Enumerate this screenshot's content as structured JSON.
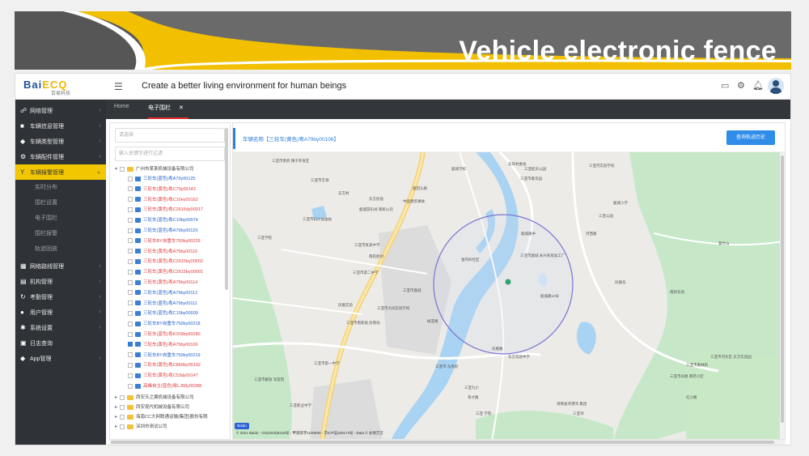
{
  "banner": {
    "title": "Vehicle electronic fence"
  },
  "app": {
    "logo_text_a": "Bai",
    "logo_text_b": "ECQ",
    "logo_sub": "百易科技",
    "slogan": "Create a better living environment for human beings",
    "menu_icon": "hamburger-icon",
    "header_icons": [
      "monitor-icon",
      "gear-icon",
      "bell-icon",
      "user-avatar-icon"
    ]
  },
  "sidebar": {
    "items": [
      {
        "label": "网络管理",
        "icon": "link-icon"
      },
      {
        "label": "车辆信息管理",
        "icon": "truck-icon"
      },
      {
        "label": "车辆类型管理",
        "icon": "cube-icon"
      },
      {
        "label": "车辆配件管理",
        "icon": "gear-icon"
      },
      {
        "label": "车辆报警管理",
        "icon": "y-icon",
        "active": true
      },
      {
        "label": "网络路线管理",
        "icon": "grid-icon"
      },
      {
        "label": "机构管理",
        "icon": "building-icon"
      },
      {
        "label": "考勤管理",
        "icon": "refresh-icon"
      },
      {
        "label": "用户管理",
        "icon": "user-icon"
      },
      {
        "label": "系统设置",
        "icon": "settings-icon"
      },
      {
        "label": "日志查询",
        "icon": "log-icon"
      },
      {
        "label": "App管理",
        "icon": "diamond-icon"
      }
    ],
    "subitems": [
      "实时分布",
      "围栏设置",
      "电子围栏",
      "围栏报警",
      "轨迹回放"
    ]
  },
  "tabs": [
    {
      "label": "Home",
      "active": false
    },
    {
      "label": "电子围栏",
      "active": true
    }
  ],
  "tree": {
    "search1_placeholder": "请选择",
    "search2_placeholder": "输入关键字进行过滤",
    "org_root": "广州市某某机械设备有限公司",
    "vehicles": [
      {
        "label": "三轮车(蓝色)粤A79y00125",
        "color": "blue",
        "checked": false
      },
      {
        "label": "三轮车(黄色)粤C79y00143",
        "color": "red",
        "checked": false
      },
      {
        "label": "三轮车(黄色)粤C10ey00162",
        "color": "red",
        "checked": false
      },
      {
        "label": "三轮车(黄色)粤C2615dy00017",
        "color": "red",
        "checked": false
      },
      {
        "label": "三轮车(蓝色)粤C10by00074",
        "color": "blue",
        "checked": false
      },
      {
        "label": "三轮车(蓝色)粤A79by00120",
        "color": "blue",
        "checked": false
      },
      {
        "label": "三轮车BY自重车750by00226",
        "color": "red",
        "checked": false
      },
      {
        "label": "三轮车(黄色)粤A79by00116",
        "color": "red",
        "checked": false
      },
      {
        "label": "三轮车(黄色)粤C2615by00002",
        "color": "red",
        "checked": false
      },
      {
        "label": "三轮车(黄色)粤C2615by00001",
        "color": "red",
        "checked": false
      },
      {
        "label": "三轮车(黄色)粤A79by00114",
        "color": "red",
        "checked": false
      },
      {
        "label": "三轮车(蓝色)粤A79by00112",
        "color": "blue",
        "checked": false
      },
      {
        "label": "三轮车(蓝色)粤A79by00111",
        "color": "blue",
        "checked": false
      },
      {
        "label": "三轮车(蓝色)粤C10by00009",
        "color": "blue",
        "checked": false
      },
      {
        "label": "三轮车BY自重车750by00218",
        "color": "blue",
        "checked": false
      },
      {
        "label": "三轮车(蓝色)粤K209by00280",
        "color": "red",
        "checked": false
      },
      {
        "label": "三轮车(黄色)粤A79by00106",
        "color": "red",
        "checked": true
      },
      {
        "label": "三轮车BY自重车750by00219",
        "color": "blue",
        "checked": false
      },
      {
        "label": "三轮车(黄色)粤C860by00192",
        "color": "red",
        "checked": false
      },
      {
        "label": "三轮车(黄色)粤C53dy00147",
        "color": "red",
        "checked": false
      },
      {
        "label": "高峰自主(蓝色)粤LJ58y00288",
        "color": "red",
        "checked": false
      }
    ],
    "orgs": [
      "西安天之翼机械设备有限公司",
      "西安现代机械设备有限公司",
      "海南CC大网联通运输(集团)股份有限",
      "深圳市测试公司"
    ]
  },
  "map_panel": {
    "vehicle_label": "车辆名称【三轮车(黄色)粤A79by00106】",
    "history_button": "查询轨迹历史",
    "copyright": "© 2021 Baidu - GS(2019)5218号 - 甲测资字1100930 - 京ICP证030173号 - Data © 长地万方",
    "baidu": "Baidu",
    "labels": [
      "三亚市南旁 镇子开发区",
      "鹿城学校",
      "东岸村委会",
      "三亚市丰源",
      "东方村",
      "东方民宿",
      "鹿回头路",
      "鹿城游乐场 南新公司",
      "三亚市口沙加油站",
      "三亚学院",
      "三亚市某某中学",
      "中国建筑事故",
      "三亚市第二中学",
      "南航新村",
      "凤凰实验",
      "三亚航天公园",
      "三亚河实验学校",
      "三亚市嘉华园",
      "三亚市鹿城",
      "三亚市南新居 房管局",
      "三亚市大同实验学校",
      "三亚市第一中学",
      "三亚市解放 军医院",
      "东方实验中学",
      "三亚九小",
      "三亚职业中学",
      "海南省湾港湾 集团",
      "三亚湾",
      "鹿城路中",
      "凤凰路",
      "榆亚路",
      "金鸡岭社区",
      "三亚公园",
      "三亚市 东风街",
      "育才路",
      "三亚市嘉林街",
      "三亚市凤凰 南苑小区",
      "三亚 学院",
      "红沙路",
      "紫竹山",
      "三亚市鹿城 永兴商贸加工厂",
      "鹿城路10号",
      "鹿城小学",
      "河西路",
      "三亚市河东区 东方实验园",
      "凤凰岛",
      "南新农场"
    ]
  },
  "colors": {
    "sidebar_bg": "#2f3338",
    "accent_yellow": "#f2c600",
    "primary_blue": "#2f8ce8",
    "fence_circle": "#7b74d6",
    "vehicle_marker": "#2fa36f",
    "river": "#a9d3f2",
    "park_green": "#bfe6c0"
  }
}
